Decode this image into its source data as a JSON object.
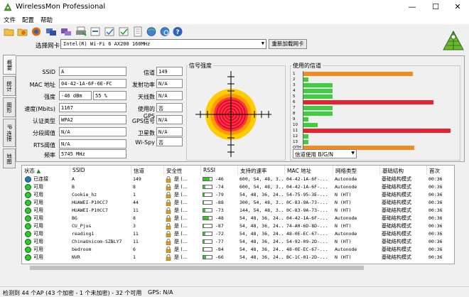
{
  "window": {
    "title": "WirelessMon Professional"
  },
  "menu": [
    "文件",
    "配置",
    "帮助"
  ],
  "toolbar": {
    "icons": [
      "open-folder-icon",
      "record-icon",
      "network-icon",
      "adapter-icon",
      "print-icon",
      "export-icon",
      "save-icon",
      "properties-icon",
      "document-icon",
      "globe-icon",
      "globe-search-icon",
      "help-icon"
    ]
  },
  "adapter": {
    "label": "选择网卡",
    "value": "Intel(R) Wi-Fi 6 AX200 160MHz",
    "reload": "重新加载网卡"
  },
  "side_tabs": [
    "概要",
    "统计",
    "图形",
    "IP 连接",
    "地图"
  ],
  "fields": {
    "ssid": {
      "label": "SSID",
      "value": "A"
    },
    "mac": {
      "label": "MAC 地址",
      "value": "04-42-1A-6F-6E-FC"
    },
    "strength": {
      "label": "强度",
      "value": "-46 dBm",
      "percent": "55 %"
    },
    "speed": {
      "label": "速度(Mbits)",
      "value": "1167"
    },
    "auth": {
      "label": "认证类型",
      "value": "WPA2"
    },
    "frag": {
      "label": "分段阈值",
      "value": "N/A"
    },
    "rts": {
      "label": "RTS阈值",
      "value": "N/A"
    },
    "freq": {
      "label": "频率",
      "value": "5745 MHz"
    },
    "channel": {
      "label": "信道",
      "value": "149"
    },
    "tx_power": {
      "label": "发射功率",
      "value": "N/A"
    },
    "antenna": {
      "label": "天线数",
      "value": "N/A"
    },
    "gps_used": {
      "label": "使用的GPS",
      "value": "否"
    },
    "gps_signal": {
      "label": "GPS信号",
      "value": "N/A"
    },
    "satellites": {
      "label": "卫星数",
      "value": "N/A"
    },
    "wispy": {
      "label": "Wi-Spy",
      "value": "否"
    }
  },
  "signal_strength": {
    "title": "信号强度",
    "colors": [
      "#ffcc00",
      "#ff9900",
      "#ff3333",
      "#cc0044"
    ]
  },
  "channels_used": {
    "title": "使用的信道",
    "select_value": "信道使用 B/G/N",
    "rows": [
      {
        "label": "1",
        "value": 0.73,
        "color": "#f28c1e"
      },
      {
        "label": "2",
        "value": 0.04,
        "color": "#3ecf3e"
      },
      {
        "label": "3",
        "value": 0.2,
        "color": "#3ecf3e"
      },
      {
        "label": "4",
        "value": 0.2,
        "color": "#3ecf3e"
      },
      {
        "label": "5",
        "value": 0.2,
        "color": "#3ecf3e"
      },
      {
        "label": "6",
        "value": 0.87,
        "color": "#e8222e"
      },
      {
        "label": "7",
        "value": 0.2,
        "color": "#3ecf3e"
      },
      {
        "label": "8",
        "value": 0.2,
        "color": "#3ecf3e"
      },
      {
        "label": "9",
        "value": 0.04,
        "color": "#3ecf3e"
      },
      {
        "label": "10",
        "value": 0.1,
        "color": "#3ecf3e"
      },
      {
        "label": "11",
        "value": 0.98,
        "color": "#e8222e"
      },
      {
        "label": "12",
        "value": 0.04,
        "color": "#3ecf3e"
      },
      {
        "label": "13",
        "value": 0.04,
        "color": "#3ecf3e"
      },
      {
        "label": "OTH",
        "value": 0.74,
        "color": "#f28c1e"
      }
    ]
  },
  "table": {
    "headers": [
      "状态",
      "SSID",
      "信道",
      "安全性",
      "RSSI",
      "支持的速率",
      "MAC 地址",
      "网络类型",
      "基础结构",
      "首次"
    ],
    "rows": [
      {
        "status": "已连接",
        "dot": "#2b6fd6",
        "ssid": "A",
        "channel": "149",
        "security": "是 (…",
        "rssi": "-46",
        "fill": 0.75,
        "rates": "600, 54, 48, 3...",
        "mac": "04-42-1A-6F-...",
        "type": "Autonode",
        "infra": "基础结构模式",
        "first": "00:36"
      },
      {
        "status": "可用",
        "dot": "#2ec82e",
        "ssid": "B",
        "channel": "8",
        "security": "是 (…",
        "rssi": "-74",
        "fill": 0.25,
        "rates": "600, 54, 48, 3...",
        "mac": "04-42-1A-6F-...",
        "type": "Autonode",
        "infra": "基础结构模式",
        "first": "00:36"
      },
      {
        "status": "可用",
        "dot": "#2ec82e",
        "ssid": "Cookie_hz",
        "channel": "1",
        "security": "是 (…",
        "rssi": "-79",
        "fill": 0.2,
        "rates": "54, 48, 36, 24...",
        "mac": "54-75-95-3E-...",
        "type": "N (HT)",
        "infra": "基础结构模式",
        "first": "00:36"
      },
      {
        "status": "可用",
        "dot": "#2ec82e",
        "ssid": "HUAWEI-P10CC7",
        "channel": "44",
        "security": "是 (…",
        "rssi": "-88",
        "fill": 0.1,
        "rates": "300, 54, 48, 3...",
        "mac": "0C-83-9A-73-...",
        "type": "N (HT)",
        "infra": "基础结构模式",
        "first": "00:36"
      },
      {
        "status": "可用",
        "dot": "#2ec82e",
        "ssid": "HUAWEI-P10CC7",
        "channel": "11",
        "security": "是 (…",
        "rssi": "-73",
        "fill": 0.25,
        "rates": "144, 54, 48, 3...",
        "mac": "0C-83-9A-73-...",
        "type": "N (HT)",
        "infra": "基础结构模式",
        "first": "00:36"
      },
      {
        "status": "可用",
        "dot": "#2ec82e",
        "ssid": "BG",
        "channel": "8",
        "security": "是 (…",
        "rssi": "-48",
        "fill": 0.7,
        "rates": "54, 48, 36, 24...",
        "mac": "04-42-1A-6F-...",
        "type": "Autonode",
        "infra": "基础结构模式",
        "first": "00:36"
      },
      {
        "status": "可用",
        "dot": "#2ec82e",
        "ssid": "CU_Pjus",
        "channel": "3",
        "security": "是 (…",
        "rssi": "-87",
        "fill": 0.1,
        "rates": "54, 48, 36, 24...",
        "mac": "74-A0-6D-8D-...",
        "type": "N (HT)",
        "infra": "基础结构模式",
        "first": "00:36"
      },
      {
        "status": "可用",
        "dot": "#2ec82e",
        "ssid": "reading1",
        "channel": "11",
        "security": "是 (…",
        "rssi": "-72",
        "fill": 0.25,
        "rates": "54, 48, 36, 24...",
        "mac": "48-0E-EC-67-...",
        "type": "Autonode",
        "infra": "基础结构模式",
        "first": "00:36"
      },
      {
        "status": "可用",
        "dot": "#2ec82e",
        "ssid": "ChinaUnicom-SZBLY7",
        "channel": "11",
        "security": "是 (…",
        "rssi": "-77",
        "fill": 0.2,
        "rates": "54, 48, 36, 24...",
        "mac": "54-92-09-2D-...",
        "type": "N (HT)",
        "infra": "基础结构模式",
        "first": "00:36"
      },
      {
        "status": "可用",
        "dot": "#2ec82e",
        "ssid": "bedroom",
        "channel": "6",
        "security": "是 (…",
        "rssi": "-84",
        "fill": 0.1,
        "rates": "54, 48, 36, 24...",
        "mac": "48-0E-EC-67-...",
        "type": "Autonode",
        "infra": "基础结构模式",
        "first": "00:36"
      },
      {
        "status": "可用",
        "dot": "#2ec82e",
        "ssid": "NVR",
        "channel": "1",
        "security": "是 (…",
        "rssi": "-66",
        "fill": 0.3,
        "rates": "54, 48, 36, 24...",
        "mac": "BC-1C-01-2D-...",
        "type": "N (HT)",
        "infra": "基础结构模式",
        "first": "00:36"
      }
    ]
  },
  "status_bar": {
    "ap_count": "检测到 44 个AP (43 个加密 - 1 个未加密) - 32 个可用",
    "gps": "GPS: N/A"
  }
}
